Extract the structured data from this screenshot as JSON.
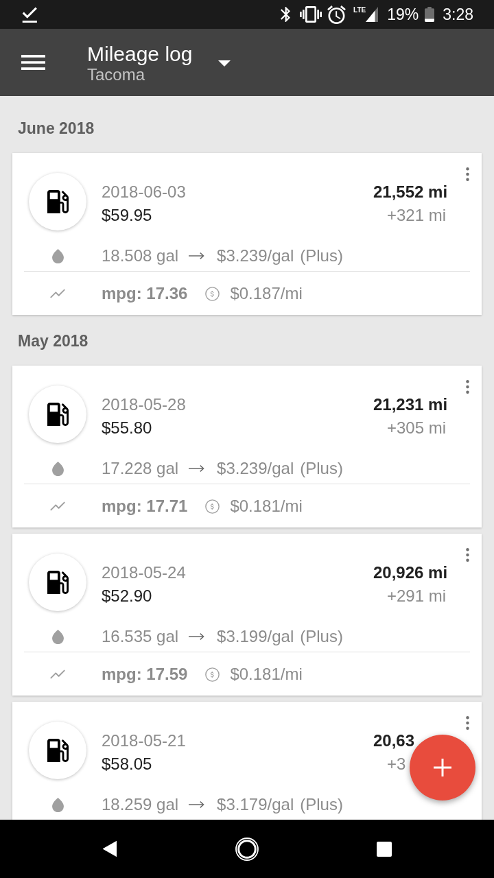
{
  "status_bar": {
    "network": "LTE",
    "battery": "19%",
    "time": "3:28"
  },
  "app_bar": {
    "title": "Mileage log",
    "subtitle": "Tacoma"
  },
  "sections": [
    {
      "title": "June 2018",
      "entries": [
        {
          "date": "2018-06-03",
          "cost": "$59.95",
          "odometer": "21,552 mi",
          "distance": "+321 mi",
          "volume": "18.508 gal",
          "price": "$3.239/gal",
          "grade": "(Plus)",
          "mpg": "mpg: 17.36",
          "cost_per_mile": "$0.187/mi"
        }
      ]
    },
    {
      "title": "May 2018",
      "entries": [
        {
          "date": "2018-05-28",
          "cost": "$55.80",
          "odometer": "21,231 mi",
          "distance": "+305 mi",
          "volume": "17.228 gal",
          "price": "$3.239/gal",
          "grade": "(Plus)",
          "mpg": "mpg: 17.71",
          "cost_per_mile": "$0.181/mi"
        },
        {
          "date": "2018-05-24",
          "cost": "$52.90",
          "odometer": "20,926 mi",
          "distance": "+291 mi",
          "volume": "16.535 gal",
          "price": "$3.199/gal",
          "grade": "(Plus)",
          "mpg": "mpg: 17.59",
          "cost_per_mile": "$0.181/mi"
        },
        {
          "date": "2018-05-21",
          "cost": "$58.05",
          "odometer": "20,63",
          "distance": "+3",
          "volume": "18.259 gal",
          "price": "$3.179/gal",
          "grade": "(Plus)"
        }
      ]
    }
  ]
}
